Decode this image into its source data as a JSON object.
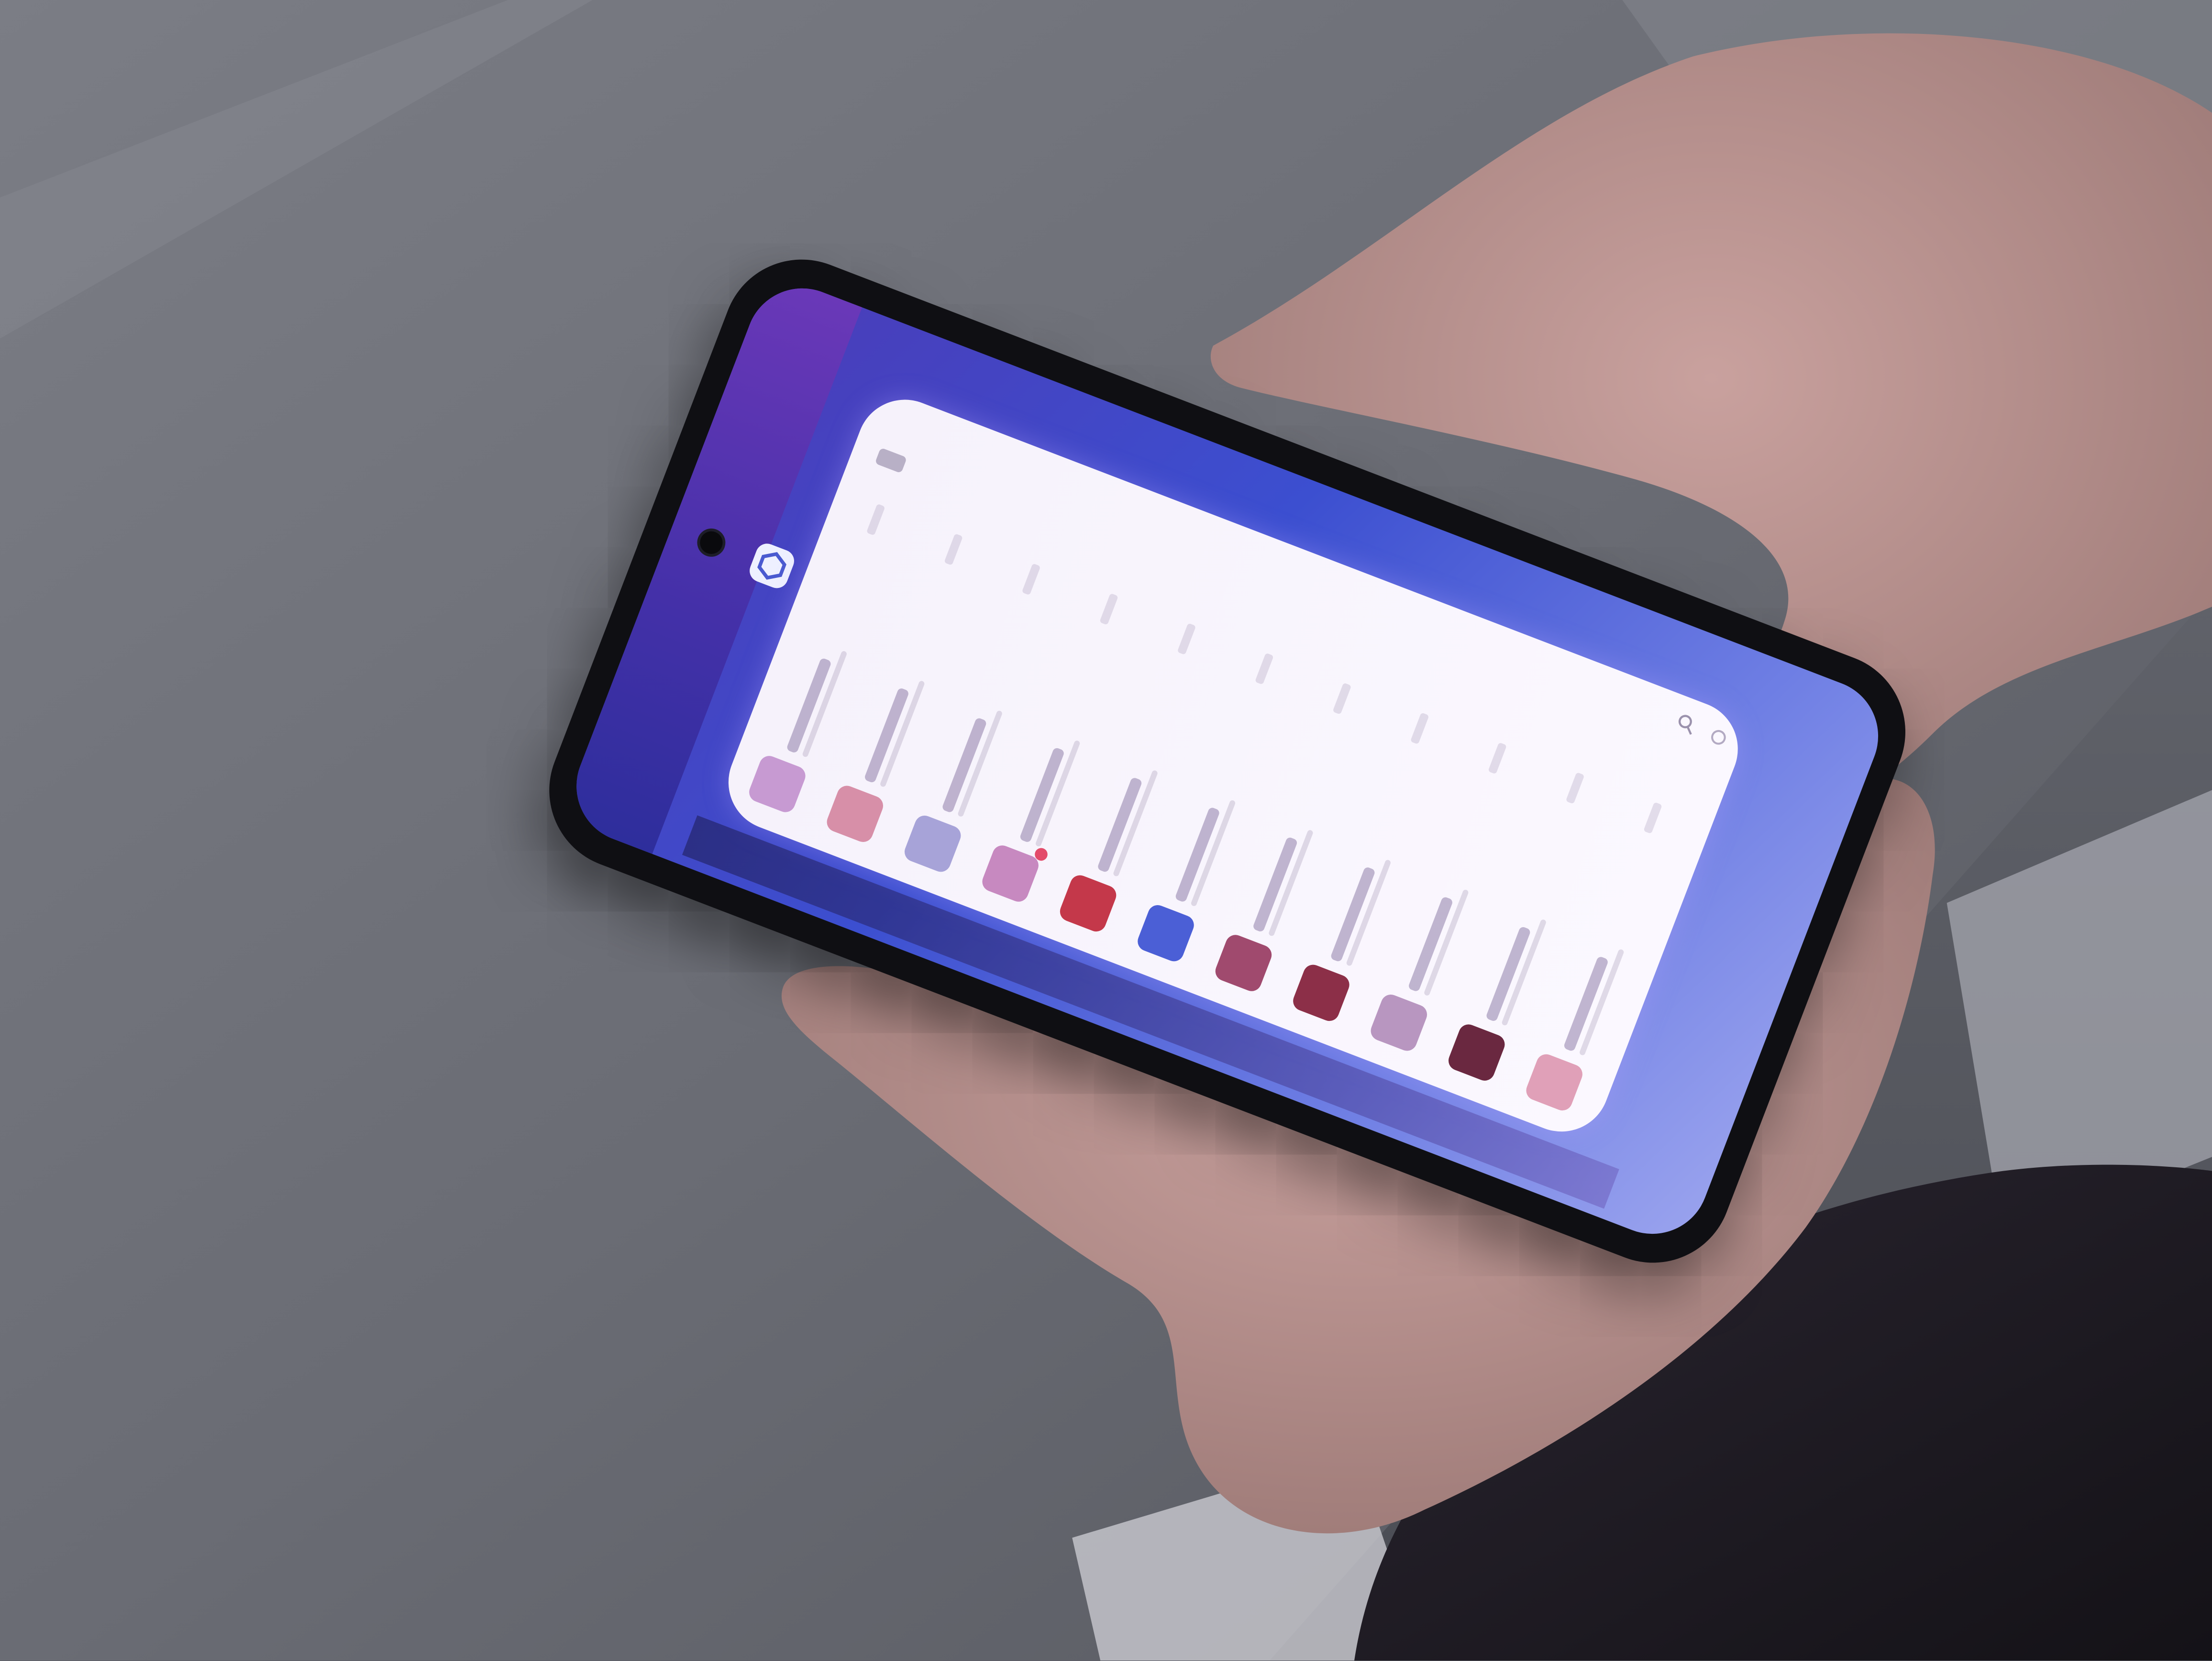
{
  "colors": {
    "screen_wallpaper": "#4a3cb8",
    "app_background": "#f7f3fb",
    "unread_badge": "#e34b6a",
    "phone_body": "#0f0f13"
  },
  "app": {
    "title": "",
    "search_icon": "search-icon",
    "settings_icon": "gear-icon"
  },
  "chats": [
    {
      "name": "",
      "preview": "",
      "time": "",
      "avatar_color": "#c79ad2",
      "unread": false
    },
    {
      "name": "",
      "preview": "",
      "time": "",
      "avatar_color": "#d78fa8",
      "unread": false
    },
    {
      "name": "",
      "preview": "",
      "time": "",
      "avatar_color": "#a7a3d8",
      "unread": false
    },
    {
      "name": "",
      "preview": "",
      "time": "",
      "avatar_color": "#c789c0",
      "unread": true
    },
    {
      "name": "",
      "preview": "",
      "time": "",
      "avatar_color": "#c4384a",
      "unread": false
    },
    {
      "name": "",
      "preview": "",
      "time": "",
      "avatar_color": "#4b5fd6",
      "unread": false
    },
    {
      "name": "",
      "preview": "",
      "time": "",
      "avatar_color": "#a04a6e",
      "unread": false
    },
    {
      "name": "",
      "preview": "",
      "time": "",
      "avatar_color": "#8c2f48",
      "unread": false
    },
    {
      "name": "",
      "preview": "",
      "time": "",
      "avatar_color": "#b896c0",
      "unread": false
    },
    {
      "name": "",
      "preview": "",
      "time": "",
      "avatar_color": "#6a2840",
      "unread": false
    },
    {
      "name": "",
      "preview": "",
      "time": "",
      "avatar_color": "#e0a0b8",
      "unread": false
    }
  ]
}
